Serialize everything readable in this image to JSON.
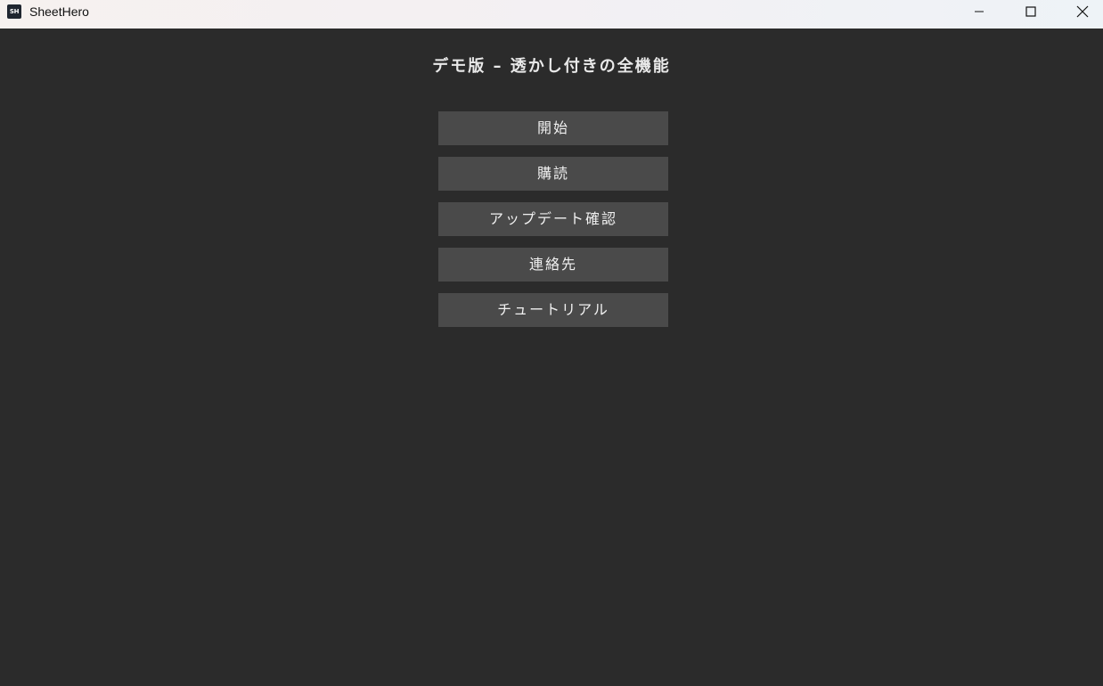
{
  "window": {
    "app_icon_text": "SH",
    "title": "SheetHero",
    "controls": {
      "minimize_icon": "minimize-icon",
      "maximize_icon": "maximize-icon",
      "close_icon": "close-icon"
    }
  },
  "main": {
    "headline": "デモ版 – 透かし付きの全機能",
    "buttons": {
      "start": "開始",
      "subscribe": "購読",
      "check_update": "アップデート確認",
      "contact": "連絡先",
      "tutorial": "チュートリアル"
    }
  },
  "colors": {
    "background": "#2b2b2b",
    "button_bg": "#4a4a4a",
    "text": "#f0f0f0"
  }
}
